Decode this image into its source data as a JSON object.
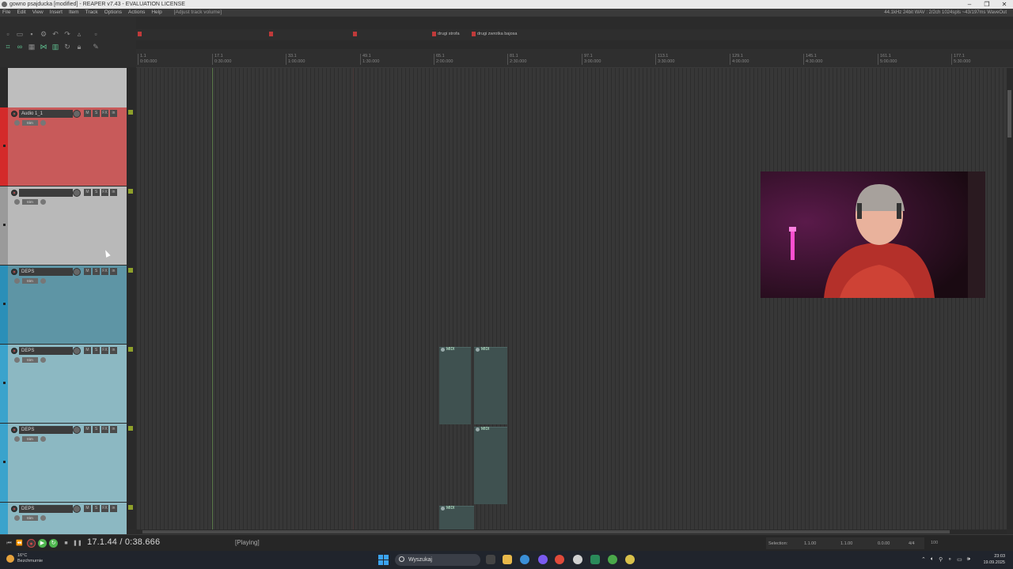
{
  "window": {
    "title": "gowno psajducka [modified] - REAPER v7.43 - EVALUATION LICENSE",
    "controls": [
      "–",
      "❐",
      "✕"
    ]
  },
  "menu": {
    "items": [
      "File",
      "Edit",
      "View",
      "Insert",
      "Item",
      "Track",
      "Options",
      "Actions",
      "Help"
    ],
    "last_action": "[Adjust track volume]",
    "status": "44.1kHz 24bit WAV : 2/2ch 1024spls ~43/197ms WaveOut"
  },
  "markers": [
    {
      "num": "1",
      "label": ""
    },
    {
      "num": "2",
      "label": ""
    },
    {
      "num": "3",
      "label": ""
    },
    {
      "num": "4",
      "label": "drugi strofa"
    },
    {
      "num": "5",
      "label": "drugi zwrotka bajosa"
    }
  ],
  "ruler": {
    "ticks": [
      "1.1",
      "17.1",
      "33.1",
      "49.1",
      "65.1",
      "81.1",
      "97.1",
      "113.1",
      "129.1",
      "145.1",
      "161.1",
      "177.1"
    ],
    "times": [
      "0:00.000",
      "0:30.000",
      "1:00.000",
      "1:30.000",
      "2:00.000",
      "2:30.000",
      "3:00.000",
      "3:30.000",
      "4:00.000",
      "4:30.000",
      "5:00.000",
      "5:30.000"
    ]
  },
  "tracks": [
    {
      "name": "Audio 1_1",
      "color": "#c85a5a",
      "strip": "#d42a2a"
    },
    {
      "name": "",
      "color": "#b9b9b9",
      "strip": "#9a9a9a"
    },
    {
      "name": "DEPS",
      "color": "#5e95a5",
      "strip": "#2a8fb8"
    },
    {
      "name": "DEPS",
      "color": "#8cb8c2",
      "strip": "#3aa3cc"
    },
    {
      "name": "DEPS",
      "color": "#8cb8c2",
      "strip": "#3aa3cc"
    },
    {
      "name": "DEPS",
      "color": "#8cb8c2",
      "strip": "#3aa3cc"
    }
  ],
  "track_buttons": {
    "fx_label": "trim",
    "mute": "M",
    "solo": "S",
    "rec_mode": "in",
    "env": "FX"
  },
  "items": [
    {
      "label": "MIDI"
    },
    {
      "label": "MIDI"
    },
    {
      "label": "MIDI"
    },
    {
      "label": "MIDI"
    }
  ],
  "transport": {
    "position": "17.1.44 / 0:38.666",
    "state": "[Playing]",
    "selection_label": "Selection:",
    "sel_start": "1.1.00",
    "sel_end": "1.1.00",
    "sel_len": "0.0.00",
    "time_sig": "4/4",
    "bpm": "100"
  },
  "taskbar": {
    "weather_temp": "16°C",
    "weather_desc": "Bezchmurnie",
    "search_placeholder": "Wyszukaj",
    "time": "23:03",
    "date": "19.09.2025"
  }
}
